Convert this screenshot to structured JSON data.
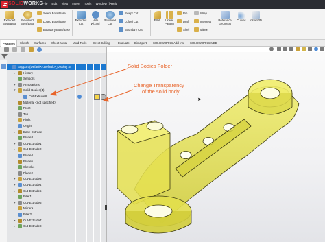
{
  "app": {
    "brand_solid": "SOLID",
    "brand_works": "WORKS"
  },
  "menus": [
    "File",
    "Edit",
    "View",
    "Insert",
    "Tools",
    "Window",
    "Help"
  ],
  "ribbon": {
    "extruded_boss": "Extruded\nBoss/Base",
    "revolved_boss": "Revolved\nBoss/Base",
    "swept_boss": "Swept Boss/Base",
    "lofted_boss": "Lofted Boss/Base",
    "boundary_boss": "Boundary Boss/Base",
    "extruded_cut": "Extruded\nCut",
    "hole_wizard": "Hole\nWizard",
    "revolved_cut": "Revolved\nCut",
    "swept_cut": "Swept Cut",
    "lofted_cut": "Lofted Cut",
    "boundary_cut": "Boundary Cut",
    "fillet": "Fillet",
    "linear_pattern": "Linear\nPattern",
    "rib": "Rib",
    "draft": "Draft",
    "shell": "Shell",
    "wrap": "Wrap",
    "intersect": "Intersect",
    "mirror": "Mirror",
    "reference_geometry": "Reference\nGeometry",
    "curves": "Curves",
    "instant3d": "Instant3D"
  },
  "tabs": [
    "Features",
    "Sketch",
    "Surfaces",
    "Sheet Metal",
    "Mold Tools",
    "Direct Editing",
    "Evaluate",
    "DimXpert",
    "SOLIDWORKS Add-Ins",
    "SOLIDWORKS MBD"
  ],
  "tree": [
    {
      "label": "Support (Default<<Default>_Display St",
      "indent": 0,
      "expand": "",
      "selected": true
    },
    {
      "label": "History",
      "indent": 1,
      "expand": "▸"
    },
    {
      "label": "Sensors",
      "indent": 1,
      "expand": ""
    },
    {
      "label": "Annotations",
      "indent": 1,
      "expand": "▸"
    },
    {
      "label": "Solid Bodies(1)",
      "indent": 1,
      "expand": "▾"
    },
    {
      "label": "Cut-Extrude8",
      "indent": 2,
      "expand": ""
    },
    {
      "label": "Material <not specified>",
      "indent": 1,
      "expand": ""
    },
    {
      "label": "Front",
      "indent": 1,
      "expand": ""
    },
    {
      "label": "Top",
      "indent": 1,
      "expand": ""
    },
    {
      "label": "Right",
      "indent": 1,
      "expand": ""
    },
    {
      "label": "Origin",
      "indent": 1,
      "expand": ""
    },
    {
      "label": "Base-Extrude",
      "indent": 1,
      "expand": "▸"
    },
    {
      "label": "Plane3",
      "indent": 1,
      "expand": ""
    },
    {
      "label": "Cut-Extrude1",
      "indent": 1,
      "expand": "▸"
    },
    {
      "label": "Cut-Extrude2",
      "indent": 1,
      "expand": "▸"
    },
    {
      "label": "Plane4",
      "indent": 1,
      "expand": ""
    },
    {
      "label": "Plane5",
      "indent": 1,
      "expand": ""
    },
    {
      "label": "Sketch4",
      "indent": 1,
      "expand": ""
    },
    {
      "label": "Plane2",
      "indent": 1,
      "expand": ""
    },
    {
      "label": "Cut-Extrude3",
      "indent": 1,
      "expand": "▸"
    },
    {
      "label": "Cut-Extrude4",
      "indent": 1,
      "expand": "▸"
    },
    {
      "label": "Cut-Extrude5",
      "indent": 1,
      "expand": "▸"
    },
    {
      "label": "Fillet1",
      "indent": 1,
      "expand": ""
    },
    {
      "label": "Cut-Extrude6",
      "indent": 1,
      "expand": "▸"
    },
    {
      "label": "Mirror1",
      "indent": 1,
      "expand": ""
    },
    {
      "label": "Fillet2",
      "indent": 1,
      "expand": ""
    },
    {
      "label": "Cut-Extrude7",
      "indent": 1,
      "expand": "▸"
    },
    {
      "label": "Cut-Extrude8",
      "indent": 1,
      "expand": "▸"
    }
  ],
  "annotations": {
    "solid_bodies": "Solid Bodies Folder",
    "transparency_line1": "Change Transparency",
    "transparency_line2": "of the solid body"
  },
  "colors": {
    "accent": "#e8642a",
    "selection": "#1b78d0",
    "part_fill": "#e3e24a",
    "part_edge": "#3c3a12"
  }
}
